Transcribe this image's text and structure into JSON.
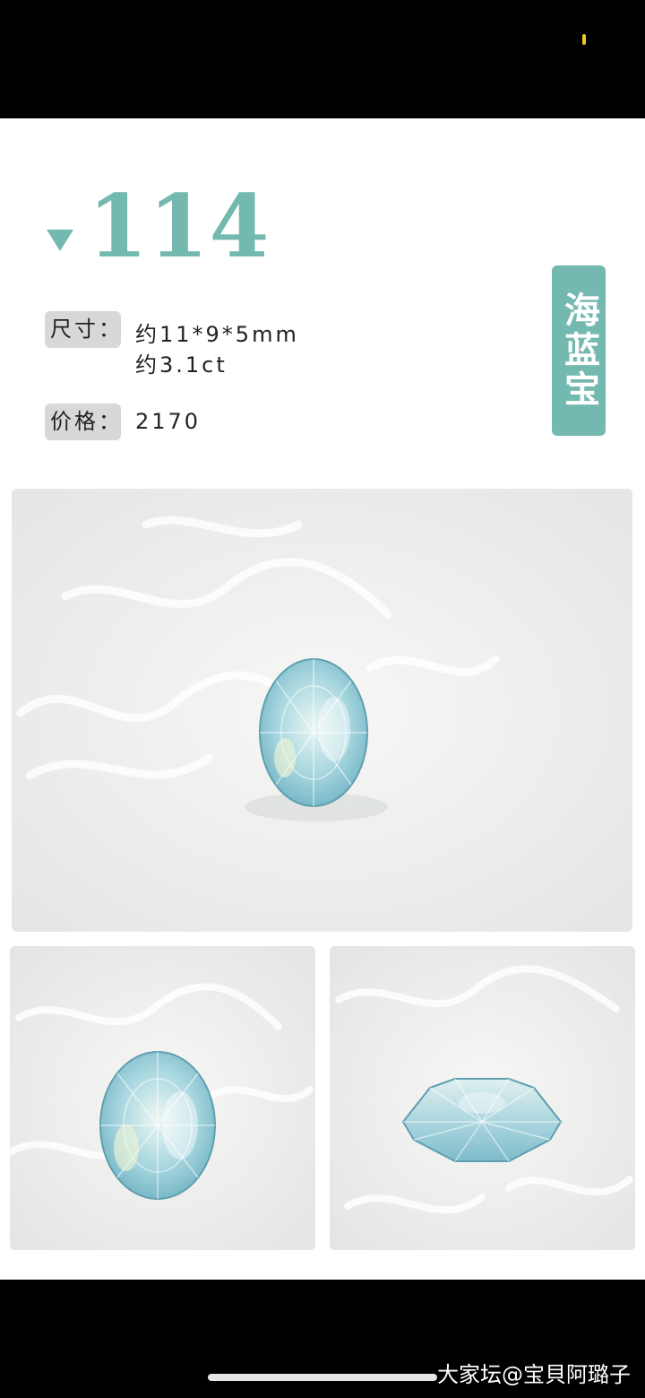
{
  "listing": {
    "number": "114",
    "size_label": "尺寸：",
    "size_line1": "约11*9*5mm",
    "size_line2": "约3.1ct",
    "price_label": "价格：",
    "price_value": "2170",
    "category": "海蓝宝"
  },
  "photos": [
    {
      "name": "gem-photo-main"
    },
    {
      "name": "gem-photo-face-up"
    },
    {
      "name": "gem-photo-side"
    }
  ],
  "watermark": "大家坛@宝貝阿璐子",
  "colors": {
    "accent": "#74b9b0",
    "pill": "#d8d8d8",
    "gem": "#9fd0da"
  }
}
